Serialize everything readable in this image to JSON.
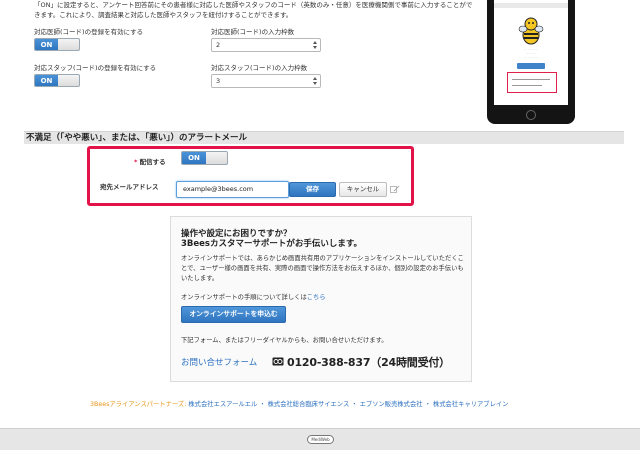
{
  "top": {
    "description": "「ON」に設定すると、アンケート回答前にその患者様に対応した医師やスタッフのコード（英数のみ・任意）を医療機関側で事前に入力することができます。これにより、調査結果と対応した医師やスタッフを紐付けすることができます。",
    "doctor_enable_label": "対応医師(コード)の登録を有効にする",
    "doctor_toggle": "ON",
    "doctor_count_label": "対応医師(コード)の入力枠数",
    "doctor_count_value": "2",
    "staff_enable_label": "対応スタッフ(コード)の登録を有効にする",
    "staff_toggle": "ON",
    "staff_count_label": "対応スタッフ(コード)の入力枠数",
    "staff_count_value": "3"
  },
  "alert": {
    "section_title": "不満足（「やや悪い」、または、「悪い」）のアラートメール",
    "required_mark": "*",
    "send_label": "配信する",
    "send_toggle": "ON",
    "email_label": "宛先メールアドレス",
    "email_value": "example@3bees.com",
    "save_label": "保存",
    "cancel_label": "キャンセル"
  },
  "support": {
    "heading1": "操作や設定にお困りですか？",
    "heading2": "3Beesカスタマーサポートがお手伝いします。",
    "body": "オンラインサポートでは、あらかじめ画面共有用のアプリケーションをインストールしていただくことで、ユーザー様の画面を共有、実際の画面で操作方法をお伝えするほか、個別の設定のお手伝いもいたします。",
    "procedure_text": "オンラインサポートの手順について詳しくは",
    "procedure_link": "こちら",
    "apply_button": "オンラインサポートを申込む",
    "note": "下記フォーム、またはフリーダイヤルからも、お問い合せいただけます。",
    "contact_link": "お問い合せフォーム",
    "phone": "0120-388-837（24時間受付）"
  },
  "partners": {
    "label": "3Beesアライアンスパートナーズ:",
    "companies": [
      "株式会社エスアールエル",
      "株式会社総合臨床サイエンス",
      "エプソン販売株式会社",
      "株式会社キャリアブレイン"
    ],
    "separator": "・"
  },
  "footer": {
    "logo_text": "MediWeb"
  },
  "colors": {
    "accent": "#2f76c0",
    "highlight": "#e3134a",
    "link": "#2a6fc1",
    "partner_label": "#e6951a"
  }
}
